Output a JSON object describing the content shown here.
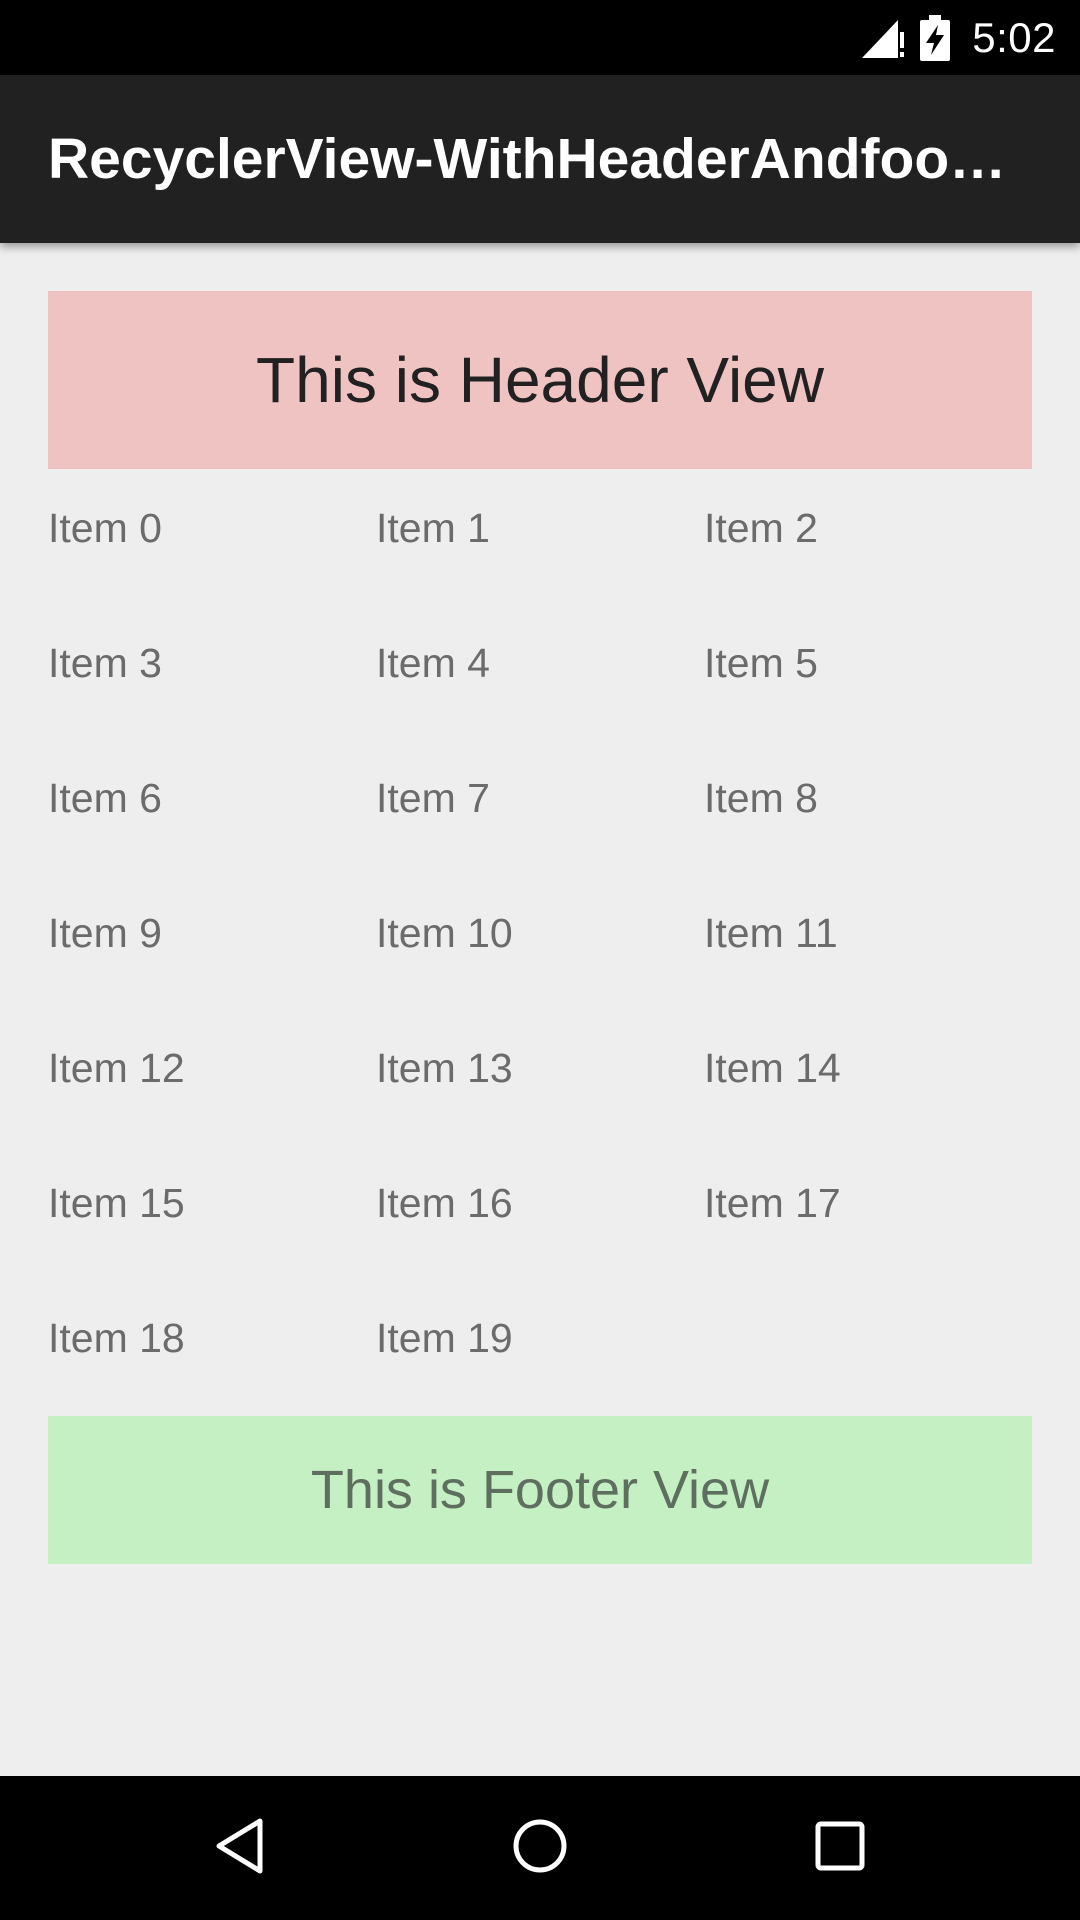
{
  "status_bar": {
    "time": "5:02",
    "icons": [
      "signal-alert-icon",
      "battery-charging-icon"
    ]
  },
  "app_bar": {
    "title": "RecyclerView-WithHeaderAndfoot…"
  },
  "header_view": {
    "text": "This is Header View",
    "background": "#f0c3c3"
  },
  "items": [
    "Item 0",
    "Item 1",
    "Item 2",
    "Item 3",
    "Item 4",
    "Item 5",
    "Item 6",
    "Item 7",
    "Item 8",
    "Item 9",
    "Item 10",
    "Item 11",
    "Item 12",
    "Item 13",
    "Item 14",
    "Item 15",
    "Item 16",
    "Item 17",
    "Item 18",
    "Item 19"
  ],
  "footer_view": {
    "text": "This is Footer View",
    "background": "#c5f0c4"
  },
  "nav_bar": {
    "buttons": [
      "back-icon",
      "home-icon",
      "recents-icon"
    ]
  },
  "colors": {
    "app_bar": "#212121",
    "background": "#eeeeee",
    "item_text": "#6b6b6b"
  }
}
